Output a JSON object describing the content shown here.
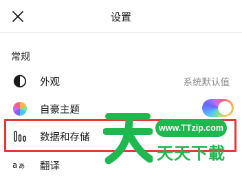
{
  "header": {
    "title": "设置",
    "close_icon": "close-icon"
  },
  "section": {
    "title": "常规"
  },
  "rows": [
    {
      "icon": "contrast-icon",
      "label": "外观",
      "value": "系统默认值"
    },
    {
      "icon": "color-wheel-icon",
      "label": "自豪主题",
      "toggle_on": true
    },
    {
      "icon": "bar-chart-icon",
      "label": "数据和存储"
    },
    {
      "icon": "translate-icon",
      "label": "翻译"
    }
  ],
  "colors": {
    "highlight_border": "#e53935",
    "watermark_green": "#1fb84e",
    "secondary_text": "#8a8a8a"
  },
  "watermark": {
    "url": "www.TTzip.com",
    "text": "天天下載"
  }
}
